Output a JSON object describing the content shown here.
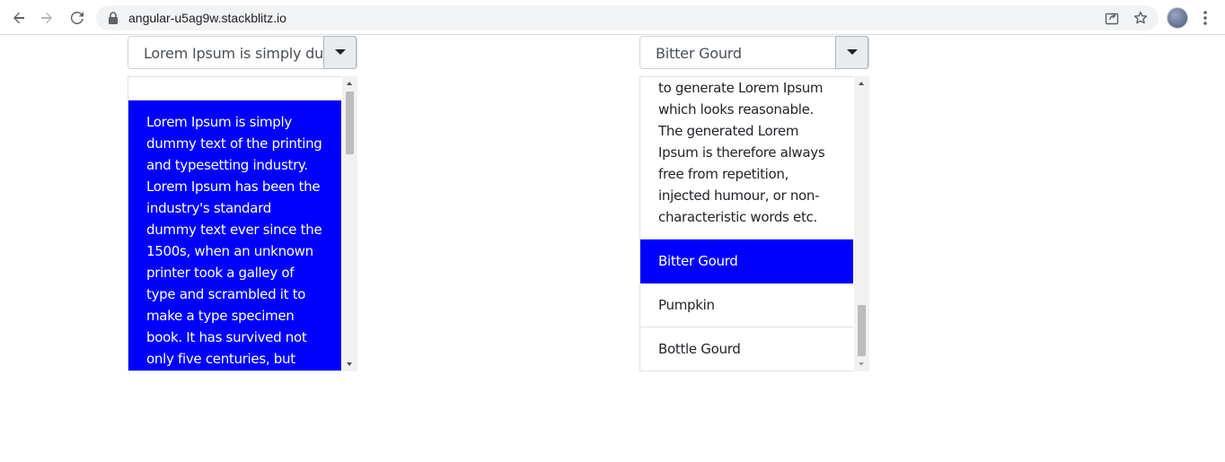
{
  "browser": {
    "url": "angular-u5ag9w.stackblitz.io"
  },
  "left_select": {
    "value": "Lorem Ipsum is simply dummy text of the printing and typesetting industry.",
    "options": [
      {
        "label": "",
        "selected": false
      },
      {
        "label": "Lorem Ipsum is simply dummy text of the printing and typesetting industry. Lorem Ipsum has been the industry's standard dummy text ever since the 1500s, when an unknown printer took a galley of type and scrambled it to make a type specimen book. It has survived not only five centuries, but also the leap",
        "selected": true
      }
    ]
  },
  "right_select": {
    "value": "Bitter Gourd",
    "options": [
      {
        "label": "to generate Lorem Ipsum which looks reasonable. The generated Lorem Ipsum is therefore always free from repetition, injected humour, or non-characteristic words etc.",
        "selected": false
      },
      {
        "label": "Bitter Gourd",
        "selected": true
      },
      {
        "label": "Pumpkin",
        "selected": false
      },
      {
        "label": "Bottle Gourd",
        "selected": false
      }
    ]
  },
  "colors": {
    "selected_option_bg": "#0000ff",
    "selected_option_text": "#ffffff"
  }
}
